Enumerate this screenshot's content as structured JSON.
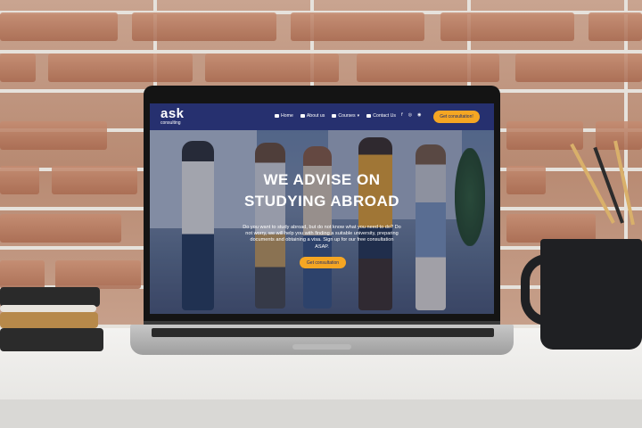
{
  "website": {
    "logo": {
      "word": "ask",
      "sub": "consulting"
    },
    "nav": {
      "items": [
        {
          "label": "Home",
          "icon": "home-icon"
        },
        {
          "label": "About us",
          "icon": "user-icon"
        },
        {
          "label": "Courses",
          "icon": "book-icon"
        },
        {
          "label": "Contact Us",
          "icon": "mail-icon"
        }
      ],
      "social": [
        "f",
        "◎",
        "◉"
      ],
      "cta_label": "Get consultation!"
    },
    "hero": {
      "title_line1": "WE ADVISE ON",
      "title_line2": "STUDYING ABROAD",
      "body": "Do you want to study abroad, but do not know what you need to do? Do not worry, we will help you with finding a suitable university, preparing documents and obtaining a visa. Sign up for our free consultation ASAP.",
      "button_label": "Get consultation"
    }
  },
  "colors": {
    "nav_bg": "#26306f",
    "accent": "#f5a623",
    "mug": "#1f2023"
  }
}
